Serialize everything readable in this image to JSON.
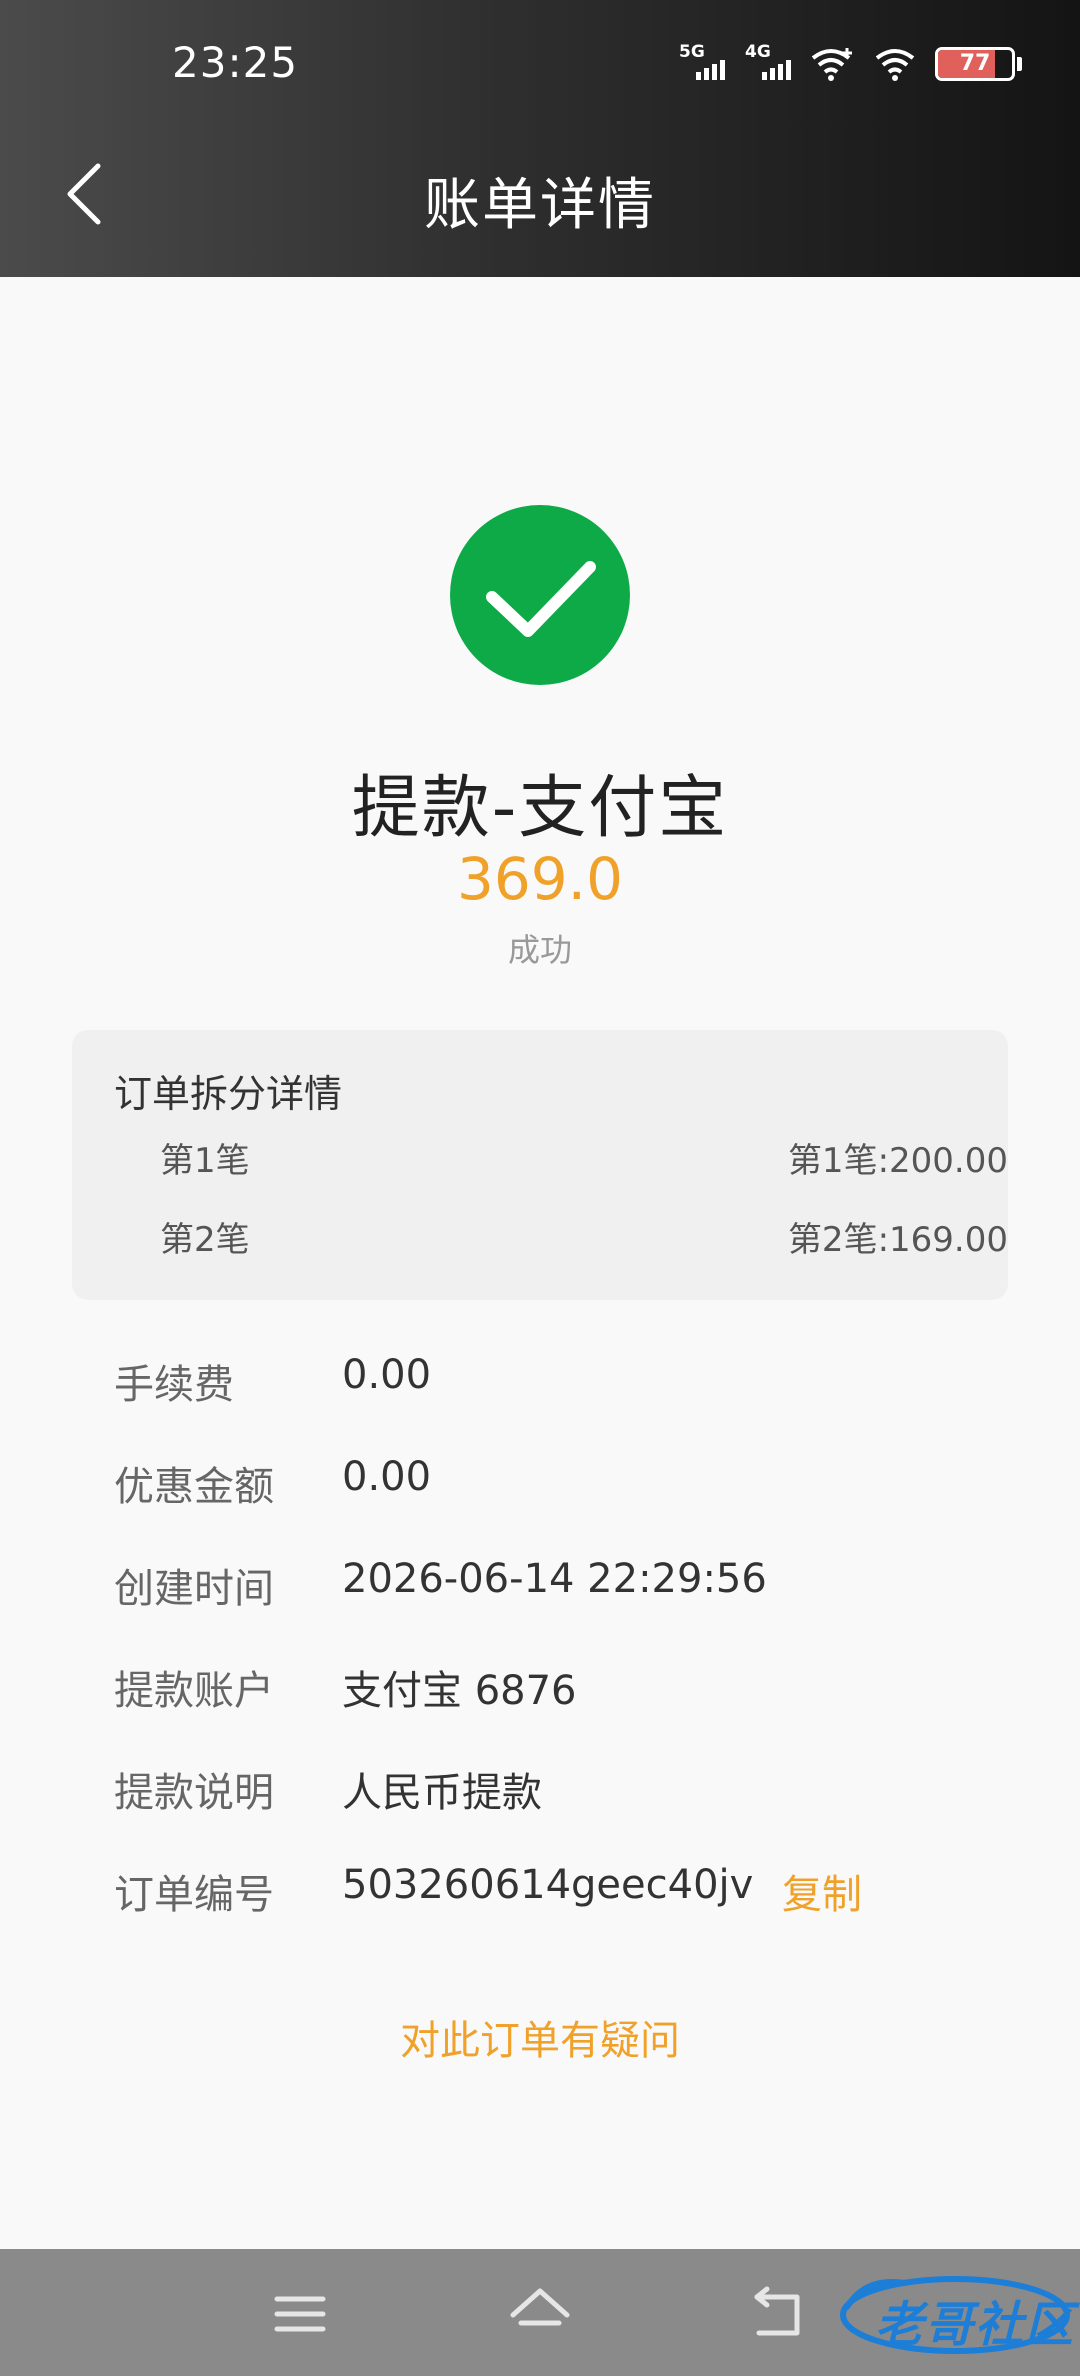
{
  "status_bar": {
    "time": "23:25",
    "network_1": "5G",
    "network_2": "4G",
    "battery": "77"
  },
  "header": {
    "title": "账单详情"
  },
  "transaction": {
    "title": "提款-支付宝",
    "amount": "369.0",
    "status": "成功",
    "status_color": "#0daa47",
    "amount_color": "#f0a12a"
  },
  "split_details": {
    "title": "订单拆分详情",
    "rows": [
      {
        "label": "第1笔",
        "value": "第1笔:200.00"
      },
      {
        "label": "第2笔",
        "value": "第2笔:169.00"
      }
    ]
  },
  "info": [
    {
      "key": "手续费",
      "value": "0.00"
    },
    {
      "key": "优惠金额",
      "value": "0.00"
    },
    {
      "key": "创建时间",
      "value": "2026-06-14 22:29:56"
    },
    {
      "key": "提款账户",
      "value": "支付宝 6876"
    },
    {
      "key": "提款说明",
      "value": "人民币提款"
    },
    {
      "key": "订单编号",
      "value": "503260614geec40jv"
    }
  ],
  "actions": {
    "copy_label": "复制",
    "question_label": "对此订单有疑问"
  },
  "watermark": {
    "text": "老哥社区"
  },
  "icons": {
    "back": "chevron-left-icon",
    "success": "check-circle-icon",
    "menu": "menu-icon",
    "home": "home-icon",
    "return": "return-icon"
  }
}
